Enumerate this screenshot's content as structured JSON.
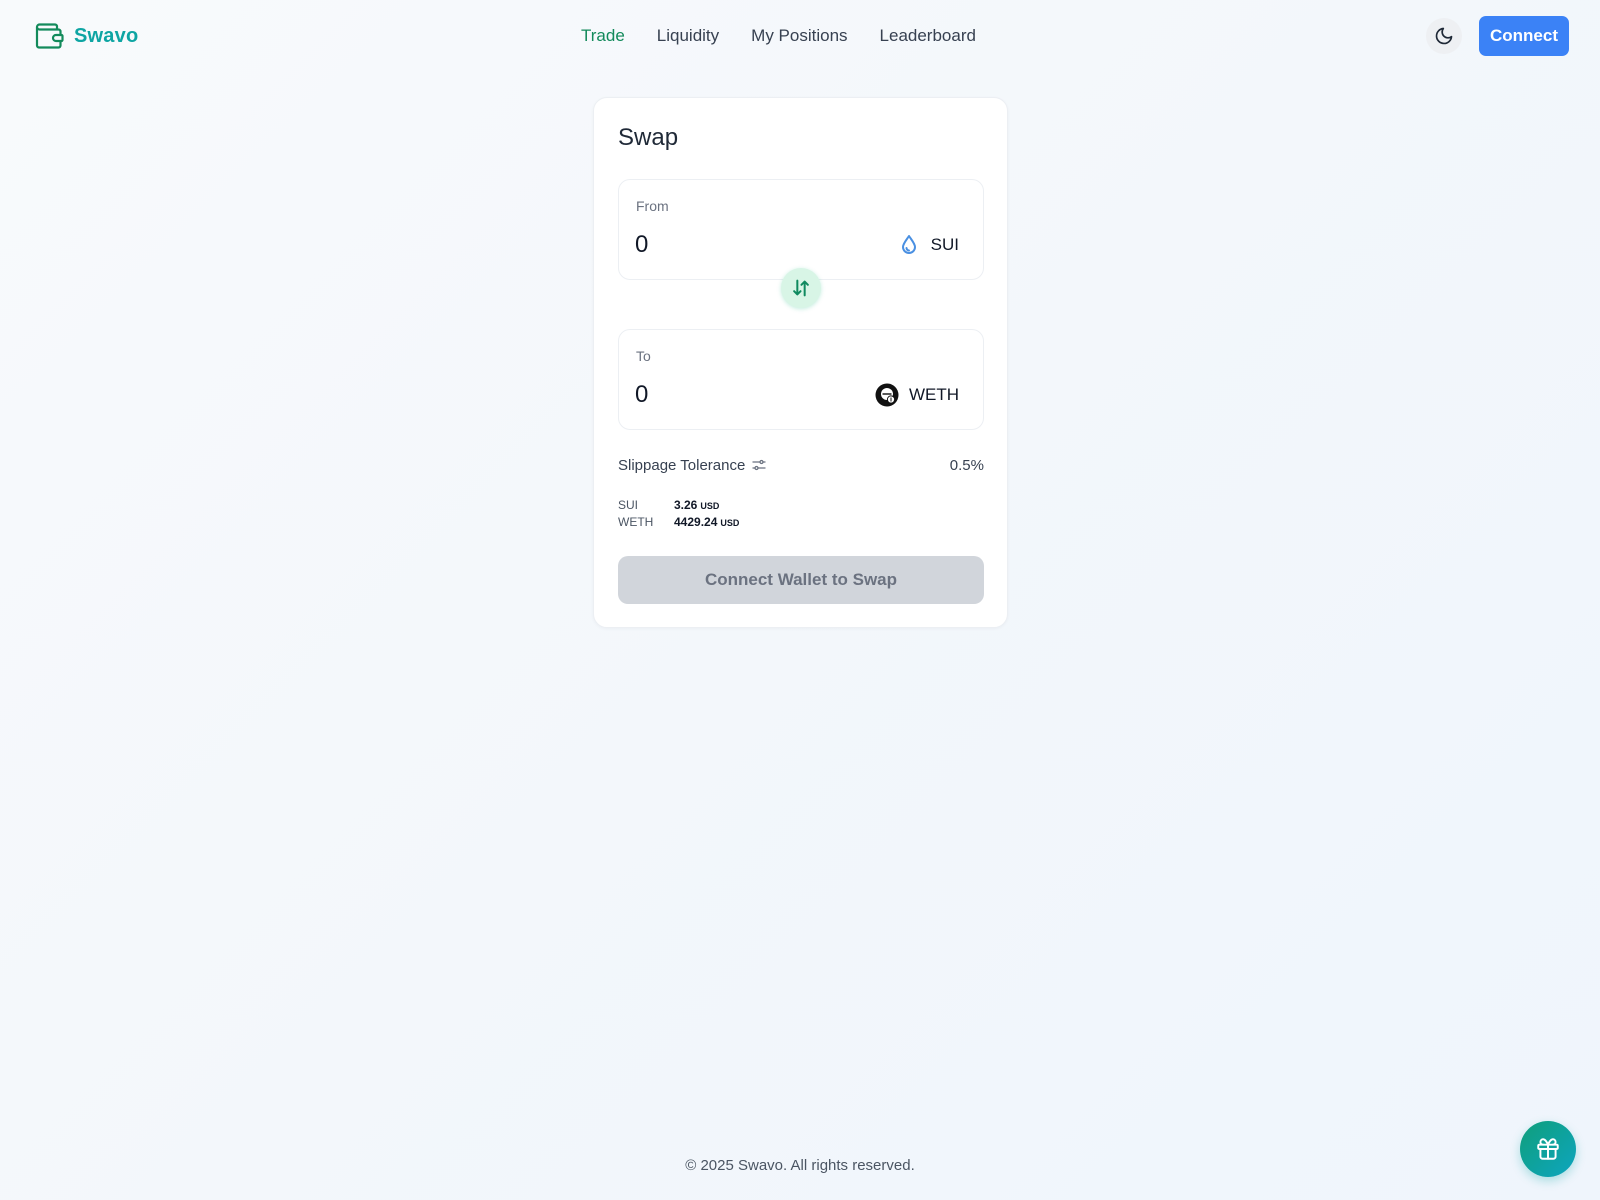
{
  "header": {
    "brand_name": "Swavo",
    "brand_icon": "wallet-icon",
    "nav": [
      {
        "label": "Trade",
        "active": true
      },
      {
        "label": "Liquidity",
        "active": false
      },
      {
        "label": "My Positions",
        "active": false
      },
      {
        "label": "Leaderboard",
        "active": false
      }
    ],
    "theme_icon": "moon-icon",
    "connect_label": "Connect"
  },
  "swap": {
    "title": "Swap",
    "from": {
      "label": "From",
      "amount": "0",
      "token": "SUI",
      "token_icon": "water-drop-icon"
    },
    "to": {
      "label": "To",
      "amount": "0",
      "token": "WETH",
      "token_icon": "weth-token-icon"
    },
    "toggle_icon": "swap-arrows-icon",
    "slippage": {
      "label": "Slippage Tolerance",
      "icon": "sliders-icon",
      "value": "0.5%"
    },
    "prices": [
      {
        "symbol": "SUI",
        "value": "3.26",
        "unit": "USD"
      },
      {
        "symbol": "WETH",
        "value": "4429.24",
        "unit": "USD"
      }
    ],
    "button_label": "Connect Wallet to Swap"
  },
  "footer": {
    "copyright": "© 2025 Swavo. All rights reserved.",
    "fab_icon": "gift-icon"
  },
  "colors": {
    "brand": "#0ea5a3",
    "nav_active": "#138a5b",
    "primary": "#3b82f6",
    "swap_toggle_bg": "#d8f5e6",
    "disabled_button": "#d1d5db"
  }
}
